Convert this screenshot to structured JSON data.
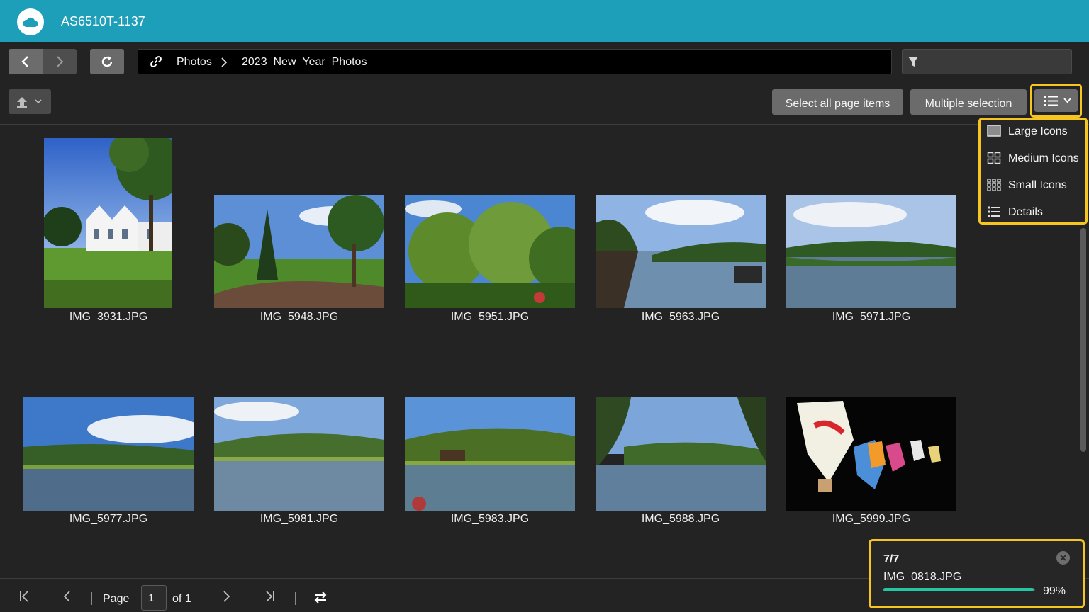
{
  "app": {
    "device_name": "AS6510T-1137",
    "logo_icon": "cloud-icon"
  },
  "toolbar": {
    "back_icon": "chevron-left-icon",
    "forward_icon": "chevron-right-icon",
    "refresh_icon": "refresh-icon",
    "upload_icon": "upload-icon",
    "filter_icon": "filter-icon",
    "filter_placeholder": "",
    "select_all_label": "Select all page items",
    "multiple_selection_label": "Multiple selection",
    "view_mode_icon": "list-icon"
  },
  "breadcrumb": {
    "link_icon": "link-icon",
    "items": [
      "Photos",
      "2023_New_Year_Photos"
    ]
  },
  "view_menu": {
    "items": [
      {
        "label": "Large Icons",
        "icon": "large-icons-icon"
      },
      {
        "label": "Medium Icons",
        "icon": "medium-icons-icon"
      },
      {
        "label": "Small Icons",
        "icon": "small-icons-icon"
      },
      {
        "label": "Details",
        "icon": "details-list-icon"
      }
    ]
  },
  "files": [
    {
      "name": "IMG_3931.JPG",
      "scene": "building"
    },
    {
      "name": "IMG_5948.JPG",
      "scene": "park"
    },
    {
      "name": "IMG_5951.JPG",
      "scene": "trees"
    },
    {
      "name": "IMG_5963.JPG",
      "scene": "lake"
    },
    {
      "name": "IMG_5971.JPG",
      "scene": "lake"
    },
    {
      "name": "IMG_5977.JPG",
      "scene": "lake"
    },
    {
      "name": "IMG_5981.JPG",
      "scene": "lake"
    },
    {
      "name": "IMG_5983.JPG",
      "scene": "lake"
    },
    {
      "name": "IMG_5988.JPG",
      "scene": "lake"
    },
    {
      "name": "IMG_5999.JPG",
      "scene": "lanterns"
    }
  ],
  "pagination": {
    "page_label": "Page",
    "current_page": "1",
    "of_label": "of 1",
    "first_icon": "first-page-icon",
    "prev_icon": "previous-page-icon",
    "next_icon": "next-page-icon",
    "last_icon": "last-page-icon",
    "swap_icon": "swap-icon"
  },
  "upload_status": {
    "count": "7/7",
    "file": "IMG_0818.JPG",
    "progress_label": "99%",
    "progress_fraction": 0.99,
    "close_icon": "close-circle-icon",
    "bar_color": "#25c6a2"
  },
  "colors": {
    "header": "#1d9fb9",
    "highlight": "#f7c520",
    "background": "#232323"
  }
}
